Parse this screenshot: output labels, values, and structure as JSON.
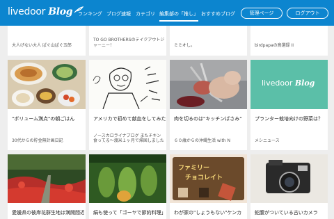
{
  "header": {
    "logo_text": "livedoor",
    "logo_blog": "Blog",
    "nav": [
      {
        "label": "ランキング",
        "active": false
      },
      {
        "label": "ブログ速報",
        "active": false
      },
      {
        "label": "カテゴリ",
        "active": false
      },
      {
        "label": "編集部の「推し」",
        "active": true
      },
      {
        "label": "おすすめブログ",
        "active": false
      }
    ],
    "manage_label": "管理ページ",
    "logout_label": "ログアウト"
  },
  "top_row": [
    {
      "meta": "大人げない大人 ぱぐ山ぱぐ五郎"
    },
    {
      "title": "TO GO BROTHERSのテイクアウトジャーニー！"
    },
    {
      "meta": "ミミオし。"
    },
    {
      "meta": "birdpapaの鳥選録 II"
    }
  ],
  "middle_row": [
    {
      "title": "\"ボリューム満点\"の朝ごはん",
      "meta": "30代からの貯金無計画日記"
    },
    {
      "title": "アメリカで初めて献血をしてみた",
      "meta": "ノースカロライナブログ またチキン食ってる〜渡米１ヶ月で帰国しました人の話"
    },
    {
      "title": "肉を切るのは\"キッチンばさみ\"",
      "meta": "６０歳からの沖縄生活 with N"
    },
    {
      "title": "プランター栽培向けの野菜は？",
      "meta": "メシニュース",
      "thumb_logo": "livedoor",
      "thumb_blog": "Blog"
    }
  ],
  "bottom_row": [
    {
      "title": "愛媛県の彼岸花群生地は満開間近"
    },
    {
      "title": "絹も使って「ゴーヤで節約料理」"
    },
    {
      "title": "わが家の\"しょうもない\"ケンカ",
      "thumb_text_1": "ファミリー",
      "thumb_text_2": "チョコレイト"
    },
    {
      "title": "蛇腹がついている古いカメラ"
    }
  ],
  "colors": {
    "header": "#0c85cf",
    "card_bg": "#ffffff",
    "page_bg": "#eeeeee",
    "teal": "#5bbfa8"
  }
}
